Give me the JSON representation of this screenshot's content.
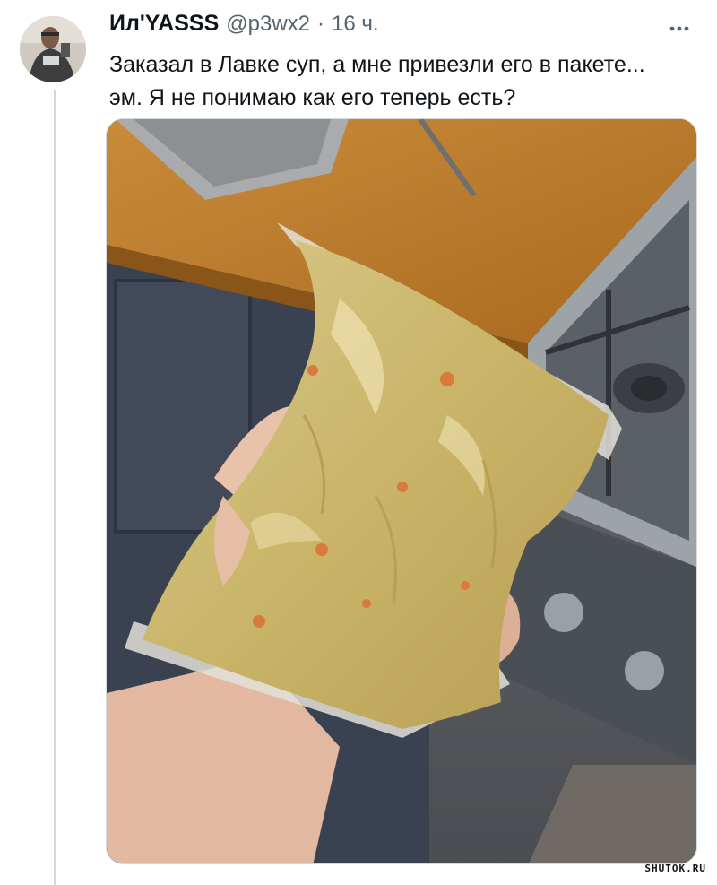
{
  "tweet": {
    "display_name": "Ил'YASSS",
    "handle": "@p3wx2",
    "separator": "·",
    "time": "16 ч.",
    "text_line_1": "Заказал в Лавке суп, а мне привезли его в пакете...",
    "text_line_2": "эм. Я не понимаю как его теперь есть?"
  },
  "media": {
    "description_icon": "photo-soup-bag"
  },
  "watermark": "SHUTOK.RU"
}
